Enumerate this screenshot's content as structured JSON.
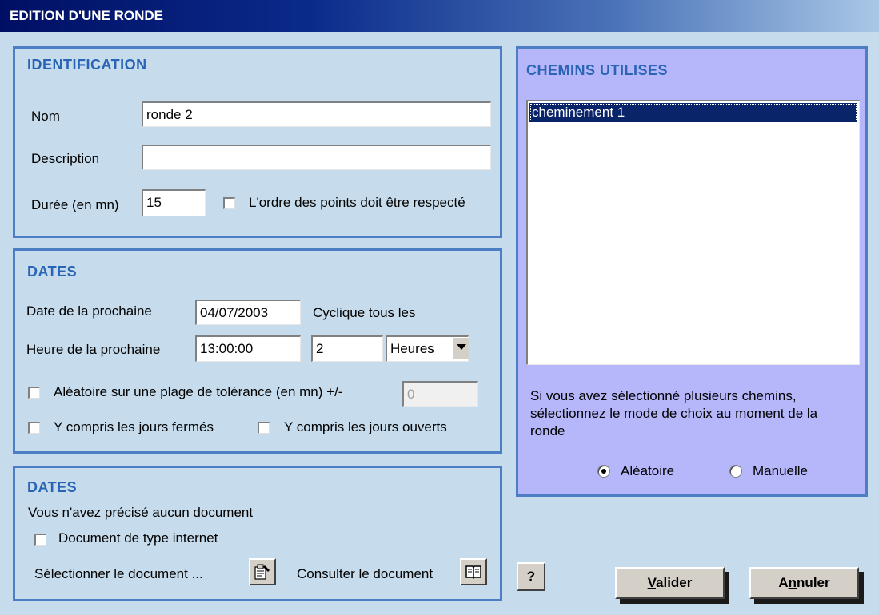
{
  "window": {
    "title": "EDITION D'UNE RONDE"
  },
  "identification": {
    "title": "IDENTIFICATION",
    "nom_label": "Nom",
    "nom_value": "ronde 2",
    "description_label": "Description",
    "description_value": "",
    "duree_label": "Durée (en mn)",
    "duree_value": "15",
    "ordre_label": "L'ordre des points doit être respecté",
    "ordre_checked": false
  },
  "dates": {
    "title": "DATES",
    "date_label": "Date de la prochaine",
    "date_value": "04/07/2003",
    "cyclique_label": "Cyclique tous les",
    "heure_label": "Heure de la prochaine",
    "heure_value": "13:00:00",
    "cycle_value": "2",
    "cycle_unit": "Heures",
    "aleatoire_label": "Aléatoire sur une plage de tolérance (en mn) +/-",
    "tolerance_value": "0",
    "fermes_label": "Y compris les jours fermés",
    "ouverts_label": "Y compris les jours ouverts"
  },
  "document": {
    "title": "DATES",
    "status": "Vous n'avez précisé aucun document",
    "internet_label": "Document de type internet",
    "select_label": "Sélectionner le document ...",
    "consult_label": "Consulter le document"
  },
  "chemins": {
    "title": "CHEMINS UTILISES",
    "items": [
      "cheminement 1"
    ],
    "info": "Si vous avez sélectionné plusieurs chemins, sélectionnez le mode de choix au moment de la ronde",
    "aleatoire_label": "Aléatoire",
    "manuelle_label": "Manuelle",
    "selected_mode": "Aléatoire"
  },
  "buttons": {
    "help": "?",
    "valider_key": "V",
    "valider_rest": "alider",
    "annuler_pre": "A",
    "annuler_key": "n",
    "annuler_rest": "nuler"
  },
  "colors": {
    "accent": "#4d7ec4",
    "section_title": "#2a64b4",
    "panel_violet": "#b6b6fb",
    "background": "#c6dcec",
    "selection": "#0a246a"
  }
}
